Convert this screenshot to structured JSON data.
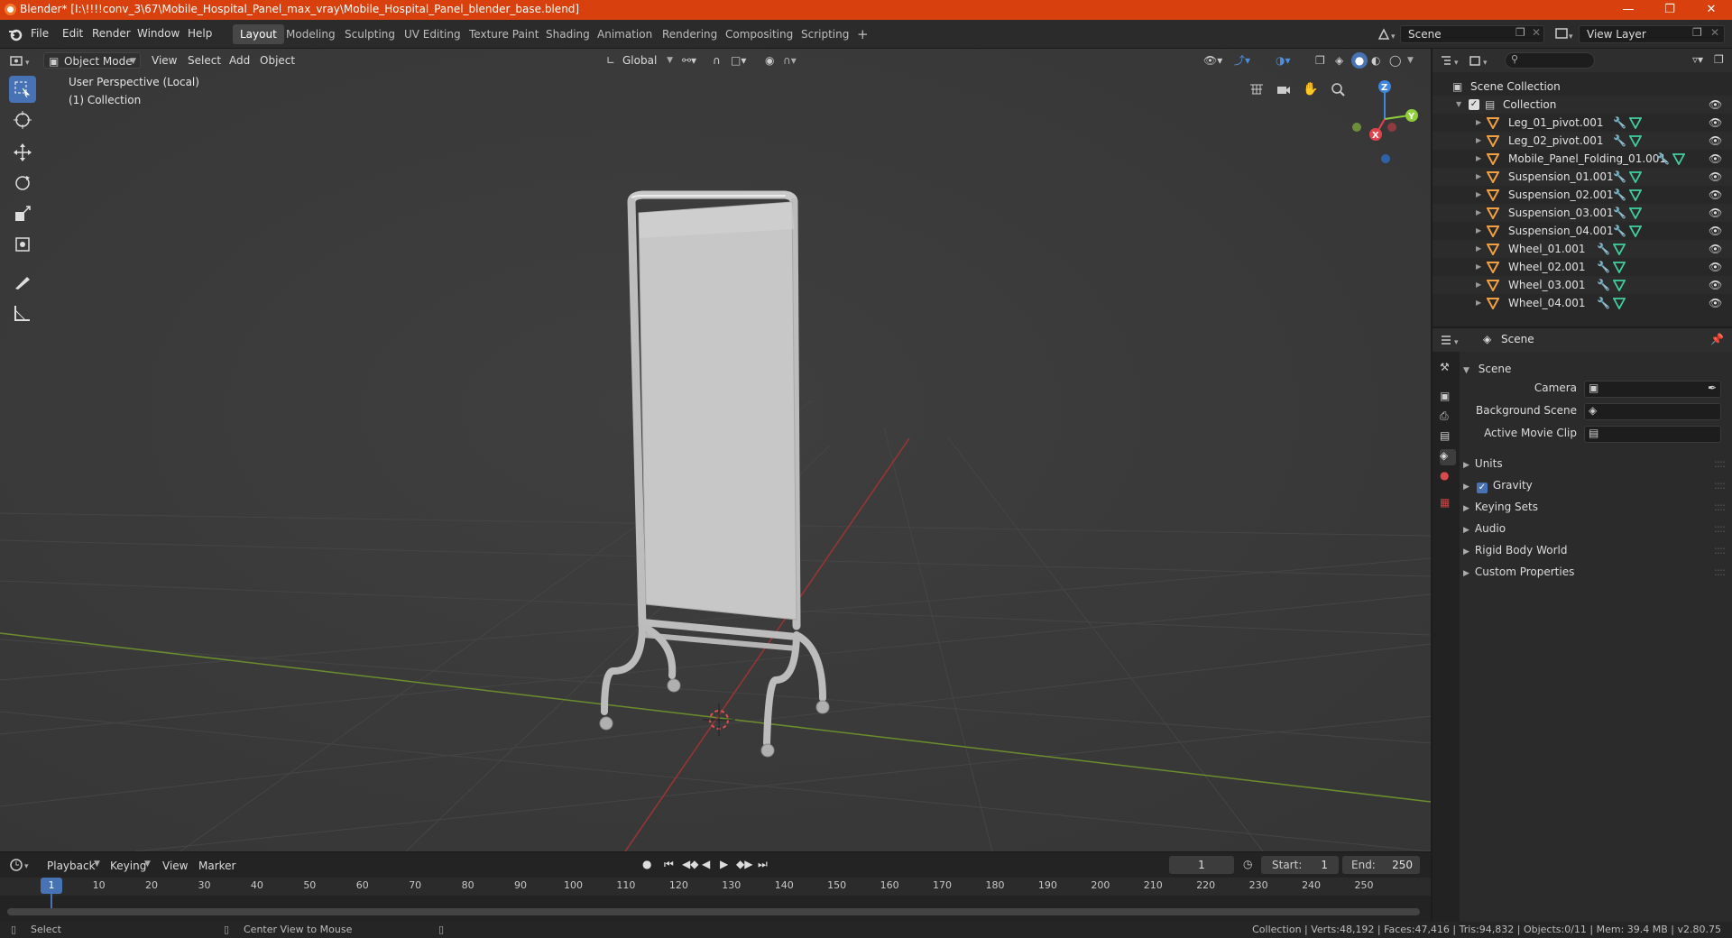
{
  "title_bar": {
    "title": "Blender* [I:\\!!!!conv_3\\67\\Mobile_Hospital_Panel_max_vray\\Mobile_Hospital_Panel_blender_base.blend]"
  },
  "menu": [
    "File",
    "Edit",
    "Render",
    "Window",
    "Help"
  ],
  "workspaces": [
    "Layout",
    "Modeling",
    "Sculpting",
    "UV Editing",
    "Texture Paint",
    "Shading",
    "Animation",
    "Rendering",
    "Compositing",
    "Scripting"
  ],
  "active_workspace": "Layout",
  "scene_field": "Scene",
  "view_layer_field": "View Layer",
  "viewport": {
    "mode": "Object Mode",
    "menus": [
      "View",
      "Select",
      "Add",
      "Object"
    ],
    "transform": "Global",
    "overlay_line1": "User Perspective (Local)",
    "overlay_line2": "(1) Collection",
    "axes": {
      "x": "X",
      "y": "Y",
      "z": "Z"
    }
  },
  "outliner": {
    "scene_collection": "Scene Collection",
    "collection": "Collection",
    "objects": [
      "Leg_01_pivot.001",
      "Leg_02_pivot.001",
      "Mobile_Panel_Folding_01.001",
      "Suspension_01.001",
      "Suspension_02.001",
      "Suspension_03.001",
      "Suspension_04.001",
      "Wheel_01.001",
      "Wheel_02.001",
      "Wheel_03.001",
      "Wheel_04.001"
    ]
  },
  "properties": {
    "context": "Scene",
    "panel": "Scene",
    "camera_label": "Camera",
    "background_scene_label": "Background Scene",
    "active_movie_clip_label": "Active Movie Clip",
    "sections": [
      "Units",
      "Gravity",
      "Keying Sets",
      "Audio",
      "Rigid Body World",
      "Custom Properties"
    ],
    "gravity_checked": true
  },
  "timeline": {
    "menus": [
      "Playback",
      "Keying",
      "View",
      "Marker"
    ],
    "current_frame": "1",
    "start_label": "Start:",
    "start": "1",
    "end_label": "End:",
    "end": "250",
    "ticks": [
      "1",
      "10",
      "20",
      "30",
      "40",
      "50",
      "60",
      "70",
      "80",
      "90",
      "100",
      "110",
      "120",
      "130",
      "140",
      "150",
      "160",
      "170",
      "180",
      "190",
      "200",
      "210",
      "220",
      "230",
      "240",
      "250"
    ]
  },
  "status": {
    "select": "Select",
    "center_view": "Center View to Mouse",
    "stats": "Collection | Verts:48,192 | Faces:47,416 | Tris:94,832 | Objects:0/11 | Mem: 39.4 MB | v2.80.75"
  },
  "colors": {
    "title_bar": "#d8400e",
    "accent": "#4772b3",
    "axis_x": "#e2424c",
    "axis_y": "#8fcf3a",
    "axis_z": "#3f86e0",
    "mesh_icon": "#f0a040"
  }
}
